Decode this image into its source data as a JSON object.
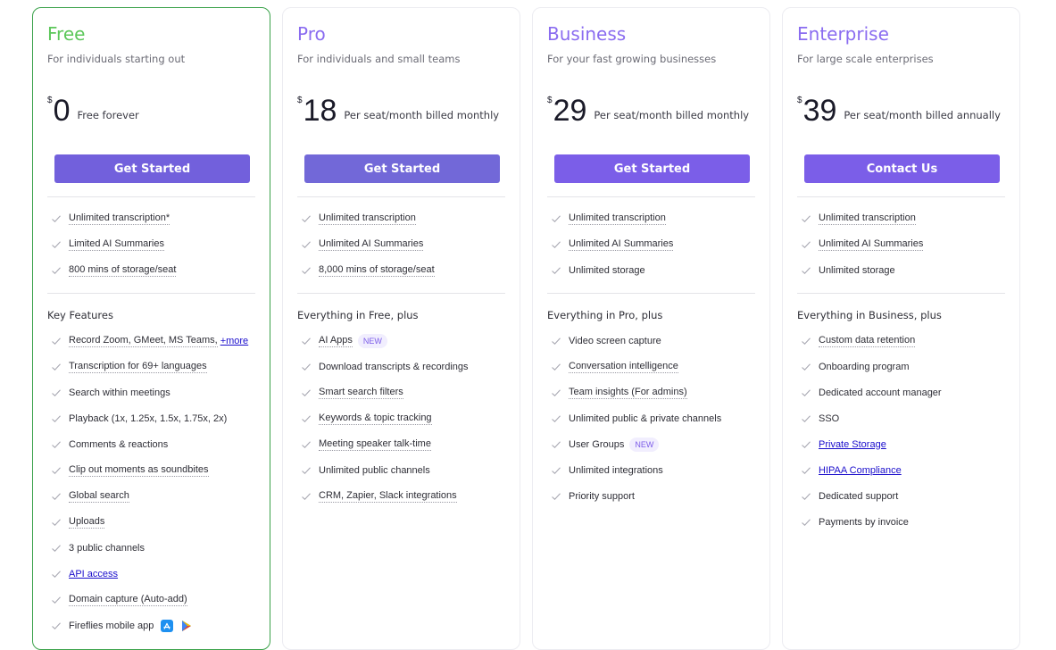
{
  "plans": [
    {
      "name": "Free",
      "name_color": "#5cc75a",
      "description": "For individuals starting out",
      "currency": "$",
      "amount": "0",
      "price_note": "Free forever",
      "cta_label": "Get Started",
      "cta_color": "#7260dc",
      "core_features": [
        {
          "text": "Unlimited transcription*"
        },
        {
          "text": "Limited AI Summaries"
        },
        {
          "text": "800 mins of storage/seat"
        }
      ],
      "section_title": "Key Features",
      "features": [
        {
          "text": "Record Zoom, GMeet, MS Teams,",
          "more": "+more"
        },
        {
          "text": "Transcription for 69+ languages"
        },
        {
          "text": "Search within meetings"
        },
        {
          "text": "Playback (1x, 1.25x, 1.5x, 1.75x, 2x)"
        },
        {
          "text": "Comments & reactions"
        },
        {
          "text": "Clip out moments as soundbites"
        },
        {
          "text": "Global search"
        },
        {
          "text": "Uploads"
        },
        {
          "text": "3 public channels"
        },
        {
          "text": "API access"
        },
        {
          "text": "Domain capture (Auto-add)"
        },
        {
          "text": "Fireflies mobile app"
        }
      ]
    },
    {
      "name": "Pro",
      "name_color": "#8a6cf0",
      "description": "For individuals and small teams",
      "currency": "$",
      "amount": "18",
      "price_note": "Per seat/month billed monthly",
      "cta_label": "Get Started",
      "cta_color": "#7268d8",
      "core_features": [
        {
          "text": "Unlimited transcription"
        },
        {
          "text": "Unlimited AI Summaries"
        },
        {
          "text": "8,000 mins of storage/seat"
        }
      ],
      "section_title": "Everything in Free, plus",
      "features": [
        {
          "text": "AI Apps",
          "badge": "NEW"
        },
        {
          "text": "Download transcripts & recordings"
        },
        {
          "text": "Smart search filters"
        },
        {
          "text": "Keywords & topic tracking"
        },
        {
          "text": "Meeting speaker talk-time"
        },
        {
          "text": "Unlimited public channels"
        },
        {
          "text": "CRM, Zapier, Slack integrations"
        }
      ]
    },
    {
      "name": "Business",
      "name_color": "#8a6cf0",
      "description": "For your fast growing businesses",
      "currency": "$",
      "amount": "29",
      "price_note": "Per seat/month billed monthly",
      "cta_label": "Get Started",
      "cta_color": "#7b5ee8",
      "core_features": [
        {
          "text": "Unlimited transcription"
        },
        {
          "text": "Unlimited AI Summaries"
        },
        {
          "text": "Unlimited storage"
        }
      ],
      "section_title": "Everything in Pro, plus",
      "features": [
        {
          "text": "Video screen capture"
        },
        {
          "text": "Conversation intelligence"
        },
        {
          "text": "Team insights (For admins)"
        },
        {
          "text": "Unlimited public & private channels"
        },
        {
          "text": "User Groups",
          "badge": "NEW"
        },
        {
          "text": "Unlimited integrations"
        },
        {
          "text": "Priority support"
        }
      ]
    },
    {
      "name": "Enterprise",
      "name_color": "#8a6cf0",
      "description": "For large scale enterprises",
      "currency": "$",
      "amount": "39",
      "price_note": "Per seat/month billed annually",
      "cta_label": "Contact Us",
      "cta_color": "#7b5ee8",
      "core_features": [
        {
          "text": "Unlimited transcription"
        },
        {
          "text": "Unlimited AI Summaries"
        },
        {
          "text": "Unlimited storage"
        }
      ],
      "section_title": "Everything in Business, plus",
      "features": [
        {
          "text": "Custom data retention"
        },
        {
          "text": "Onboarding program"
        },
        {
          "text": "Dedicated account manager"
        },
        {
          "text": "SSO"
        },
        {
          "text": "Private Storage"
        },
        {
          "text": "HIPAA Compliance"
        },
        {
          "text": "Dedicated support"
        },
        {
          "text": "Payments by invoice"
        }
      ]
    }
  ],
  "icons": {
    "check": "check-icon",
    "app_store": "app-store-icon",
    "play_store": "google-play-icon"
  }
}
